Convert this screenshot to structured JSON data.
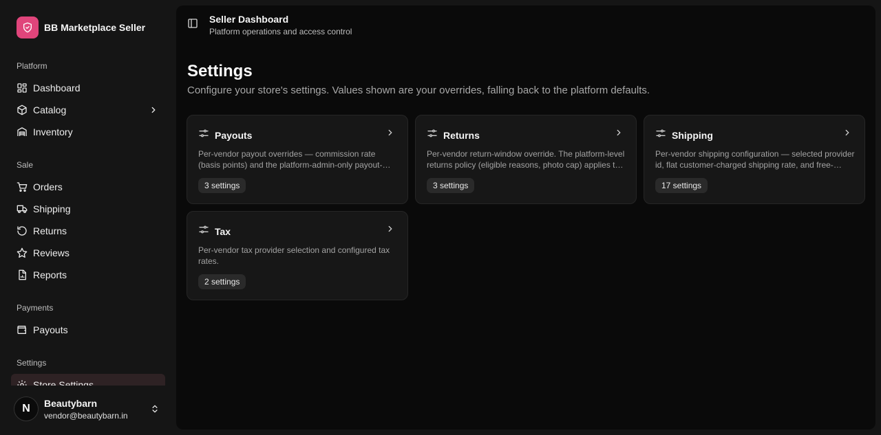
{
  "brand": {
    "name": "BB Marketplace Seller",
    "logo_icon": "shield-icon",
    "accent": "#e0457b"
  },
  "sidebar": {
    "groups": [
      {
        "label": "Platform",
        "items": [
          {
            "label": "Dashboard",
            "icon": "dashboard-icon"
          },
          {
            "label": "Catalog",
            "icon": "package-icon",
            "has_submenu": true
          },
          {
            "label": "Inventory",
            "icon": "warehouse-icon"
          }
        ]
      },
      {
        "label": "Sale",
        "items": [
          {
            "label": "Orders",
            "icon": "cart-icon"
          },
          {
            "label": "Shipping",
            "icon": "truck-icon"
          },
          {
            "label": "Returns",
            "icon": "undo-icon"
          },
          {
            "label": "Reviews",
            "icon": "star-icon"
          },
          {
            "label": "Reports",
            "icon": "report-icon"
          }
        ]
      },
      {
        "label": "Payments",
        "items": [
          {
            "label": "Payouts",
            "icon": "wallet-icon"
          }
        ]
      },
      {
        "label": "Settings",
        "items": [
          {
            "label": "Store Settings",
            "icon": "gear-icon",
            "active": true
          }
        ]
      }
    ]
  },
  "user": {
    "name": "Beautybarn",
    "email": "vendor@beautybarn.in",
    "initial": "N"
  },
  "header": {
    "title": "Seller Dashboard",
    "subtitle": "Platform operations and access control"
  },
  "page": {
    "title": "Settings",
    "description": "Configure your store's settings. Values shown are your overrides, falling back to the platform defaults."
  },
  "cards": [
    {
      "title": "Payouts",
      "description": "Per-vendor payout overrides — commission rate (basis points) and the platform-admin-only payout-hold flag.",
      "count": "3 settings"
    },
    {
      "title": "Returns",
      "description": "Per-vendor return-window override. The platform-level returns policy (eligible reasons, photo cap) applies to all vendors.",
      "count": "3 settings"
    },
    {
      "title": "Shipping",
      "description": "Per-vendor shipping configuration — selected provider id, flat customer-charged shipping rate, and free-shipping threshold.",
      "count": "17 settings"
    },
    {
      "title": "Tax",
      "description": "Per-vendor tax provider selection and configured tax rates.",
      "count": "2 settings"
    }
  ]
}
